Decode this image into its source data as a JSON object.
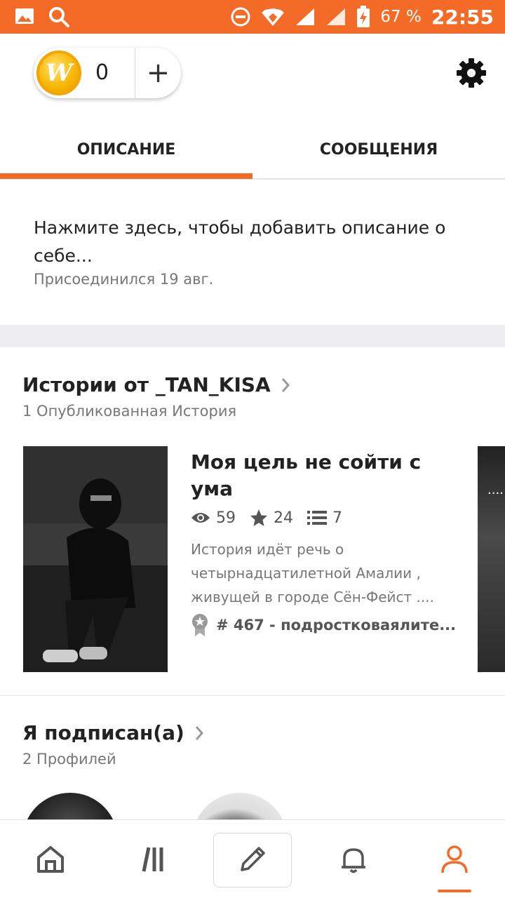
{
  "status_bar": {
    "battery": "67 %",
    "time": "22:55",
    "icons": [
      "image-icon",
      "search-icon",
      "dnd-icon",
      "wifi-icon",
      "signal-icon",
      "signal-icon",
      "battery-charging-icon"
    ]
  },
  "header": {
    "coin_count": "0",
    "add_coins": "+",
    "coin_letter": "W"
  },
  "tabs": [
    {
      "label": "ОПИСАНИЕ",
      "active": true
    },
    {
      "label": "СООБЩЕНИЯ",
      "active": false
    }
  ],
  "about": {
    "description_prompt": "Нажмите здесь, чтобы добавить описание о себе...",
    "joined": "Присоединился 19 авг."
  },
  "stories": {
    "title": "Истории от _TAN_KISA",
    "subtitle": "1 Опубликованная История",
    "items": [
      {
        "title": "Моя цель не сойти с ума",
        "reads": "59",
        "votes": "24",
        "parts": "7",
        "blurb": "История идёт речь о четырнадцатилетной Амалии , живущей в городе Сён-Фейст ....",
        "rank": "# 467 - подростковаялите..."
      }
    ],
    "next_card_dots": "...."
  },
  "following": {
    "title": "Я подписан(а)",
    "subtitle": "2 Профилей"
  },
  "colors": {
    "accent": "#f46b28",
    "text": "#222222",
    "secondary_text": "#777777"
  },
  "bottom_nav": [
    {
      "name": "home-icon"
    },
    {
      "name": "library-icon"
    },
    {
      "name": "write-icon"
    },
    {
      "name": "notifications-icon"
    },
    {
      "name": "profile-icon",
      "active": true
    }
  ]
}
